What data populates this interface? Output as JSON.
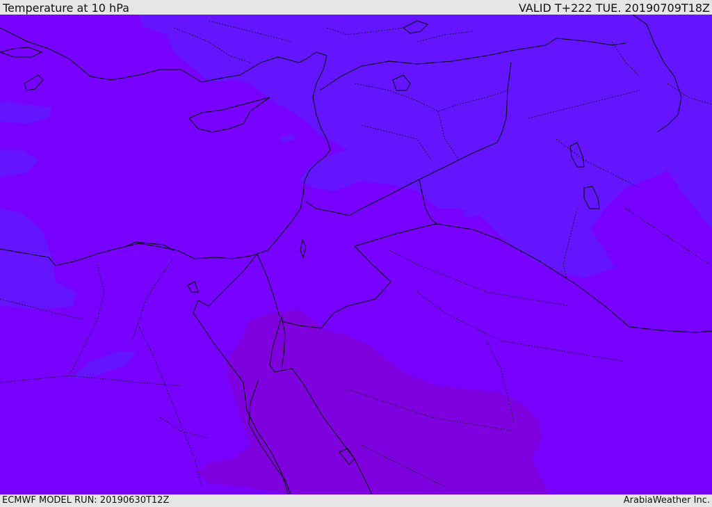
{
  "header": {
    "title": "Temperature at 10 hPa",
    "valid_time": "VALID T+222 TUE. 20190709T18Z"
  },
  "footer": {
    "model_run": "ECMWF MODEL RUN: 20190630T12Z",
    "credit": "ArabiaWeather Inc."
  },
  "map": {
    "parameter": "Temperature",
    "level": "10 hPa",
    "colors": {
      "base_field": "#7700ff",
      "cooler_field": "#6414ff",
      "warmer_field": "#7f00de",
      "coastline": "#000000",
      "border": "#000000"
    }
  }
}
